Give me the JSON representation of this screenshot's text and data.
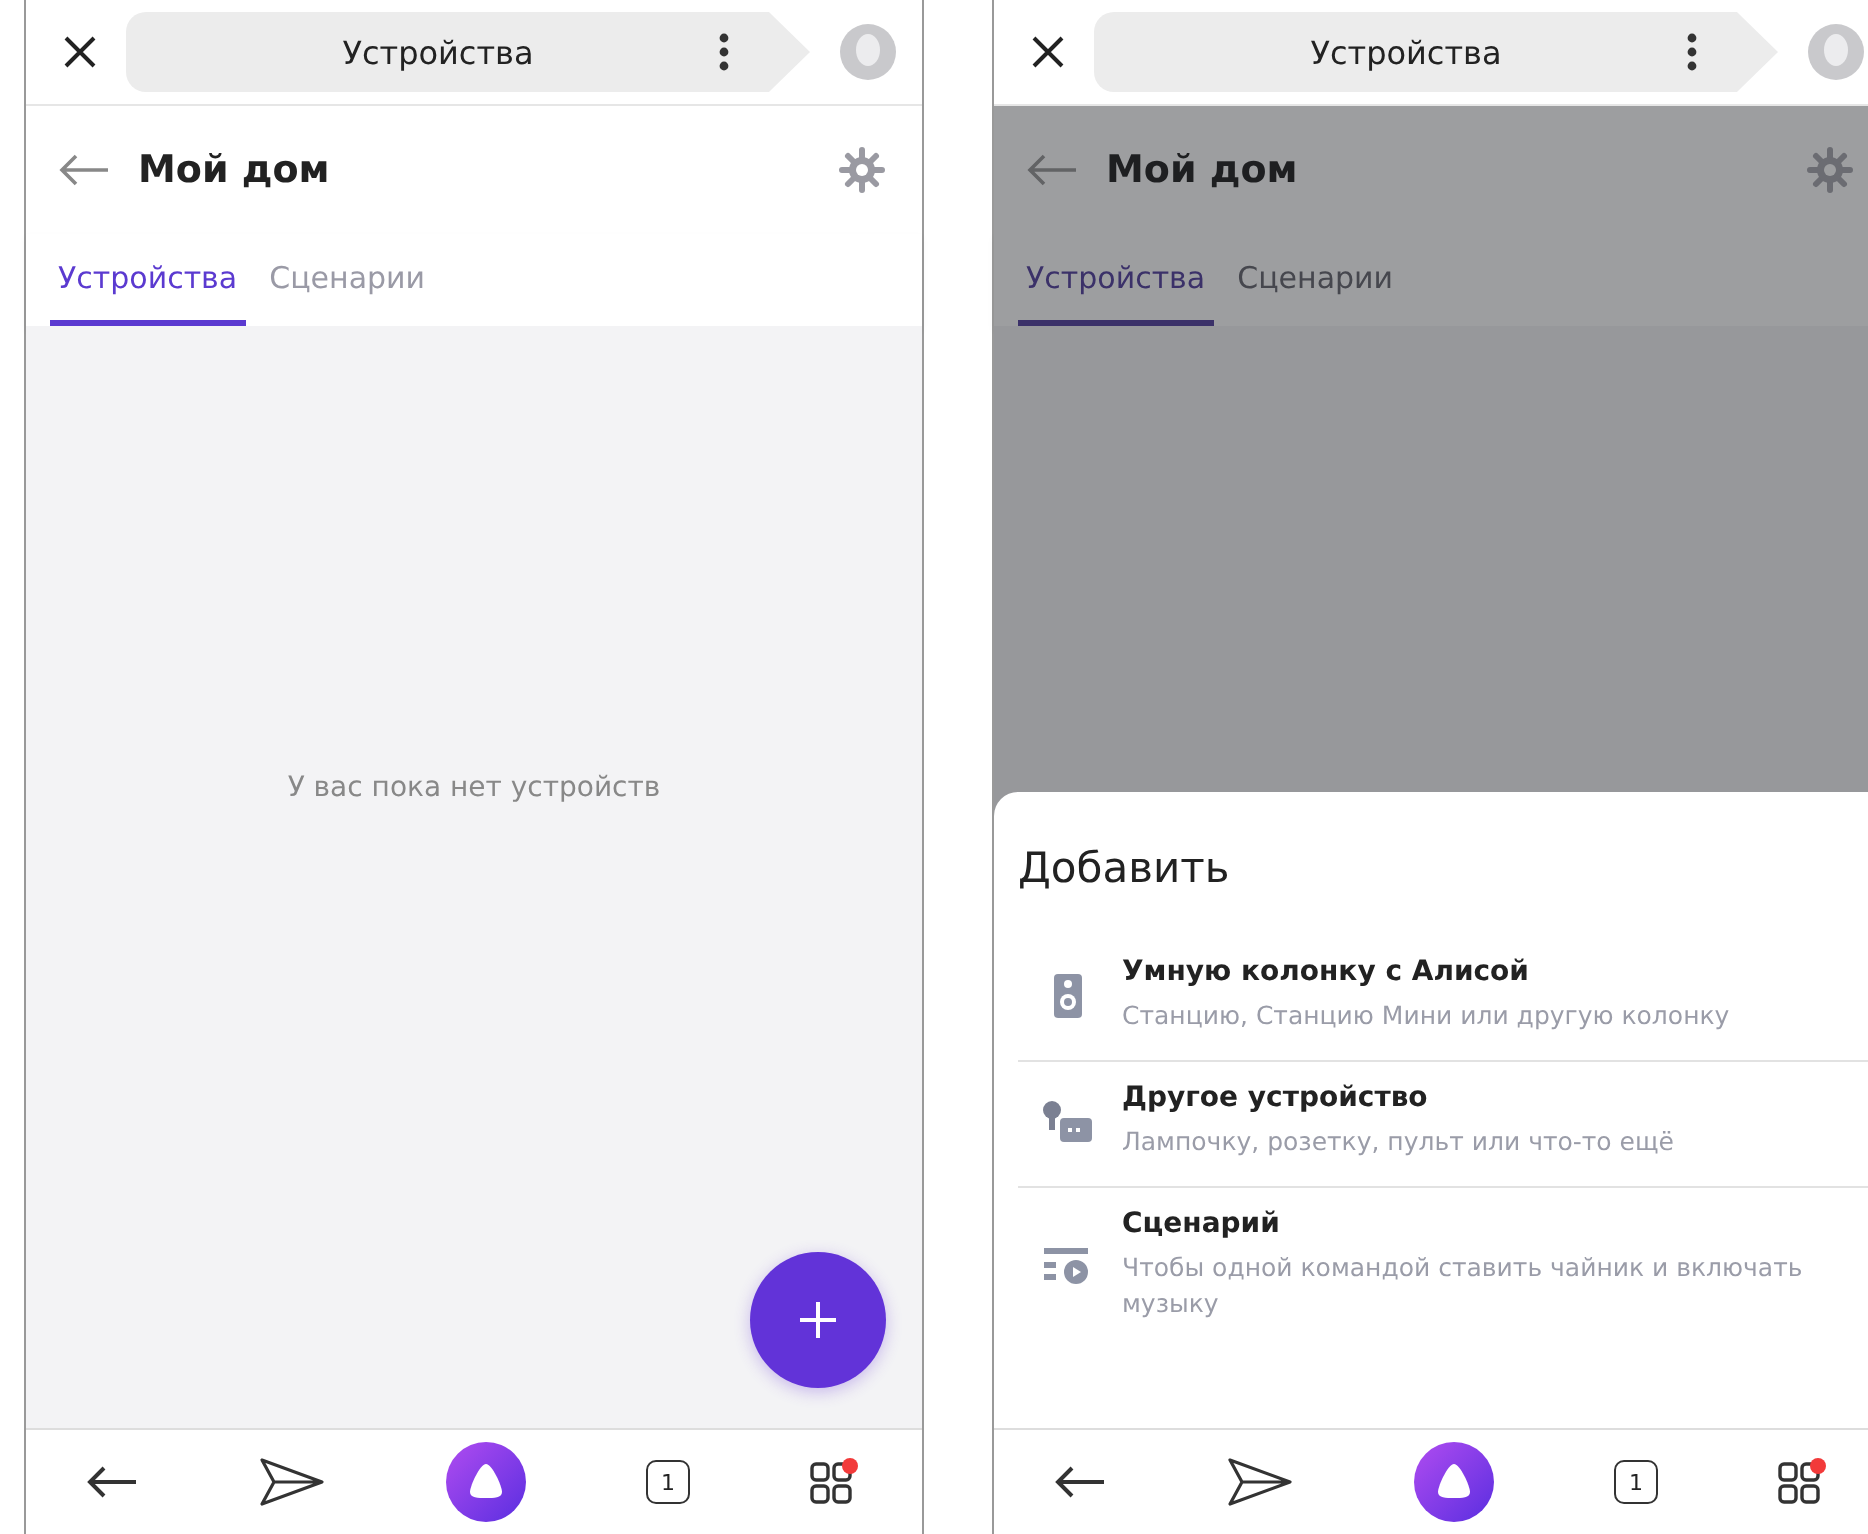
{
  "screens": [
    {
      "top_bar": {
        "title": "Устройства"
      },
      "header": {
        "title": "Мой дом"
      },
      "tabs": [
        {
          "label": "Устройства",
          "selected": true
        },
        {
          "label": "Сценарии",
          "selected": false
        }
      ],
      "empty_text": "У вас пока нет устройств",
      "add_button": true,
      "nav": {
        "tab_count": "1",
        "notification": true
      }
    },
    {
      "top_bar": {
        "title": "Устройства"
      },
      "header": {
        "title": "Мой дом"
      },
      "tabs": [
        {
          "label": "Устройства",
          "selected": true
        },
        {
          "label": "Сценарии",
          "selected": false
        }
      ],
      "dimmed": true,
      "sheet": {
        "title": "Добавить",
        "items": [
          {
            "kind": "speaker",
            "title": "Умную колонку с Алисой",
            "subtitle": "Станцию, Станцию Мини или другую колонку"
          },
          {
            "kind": "device",
            "title": "Другое устройство",
            "subtitle": "Лампочку, розетку, пульт или что-то ещё"
          },
          {
            "kind": "scenario",
            "title": "Сценарий",
            "subtitle": "Чтобы одной командой ставить чайник и включать музыку"
          }
        ]
      },
      "nav": {
        "tab_count": "1",
        "notification": true
      }
    }
  ]
}
